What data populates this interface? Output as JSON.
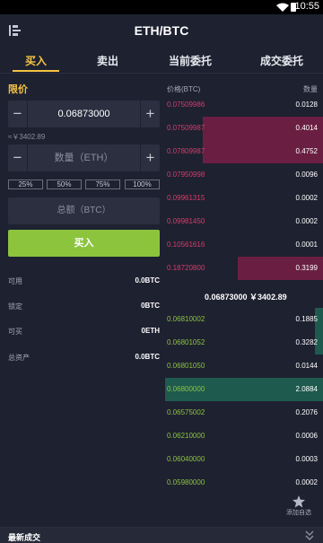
{
  "status_bar": {
    "time": "10:55",
    "wifi_icon": "wifi-icon",
    "battery_icon": "battery-icon"
  },
  "header": {
    "title": "ETH/BTC",
    "back_icon": "switch-pair-icon"
  },
  "tabs": [
    {
      "label": "买入",
      "active": true
    },
    {
      "label": "卖出",
      "active": false
    },
    {
      "label": "当前委托",
      "active": false
    },
    {
      "label": "成交委托",
      "active": false
    }
  ],
  "order_form": {
    "order_type": "限价",
    "price_value": "0.06873000",
    "price_cny": "≈￥3402.89",
    "amount_placeholder": "数量（ETH）",
    "percents": [
      "25%",
      "50%",
      "75%",
      "100%"
    ],
    "total_placeholder": "总额（BTC）",
    "buy_label": "买入",
    "minus_label": "−",
    "plus_label": "+"
  },
  "balances": [
    {
      "label": "可用",
      "value": "0.0BTC"
    },
    {
      "label": "锁定",
      "value": "0BTC"
    },
    {
      "label": "可买",
      "value": "0ETH"
    },
    {
      "label": "总资产",
      "value": "0.0BTC"
    }
  ],
  "orderbook": {
    "header_price": "价格(BTC)",
    "header_qty": "数量",
    "asks": [
      {
        "price": "0.07509986",
        "qty": "0.0128",
        "depth": 0.0
      },
      {
        "price": "0.07509987",
        "qty": "0.4014",
        "depth": 0.76
      },
      {
        "price": "0.07809987",
        "qty": "0.4752",
        "depth": 0.76
      },
      {
        "price": "0.07950998",
        "qty": "0.0096",
        "depth": 0.0
      },
      {
        "price": "0.09961315",
        "qty": "0.0002",
        "depth": 0.0
      },
      {
        "price": "0.09981450",
        "qty": "0.0002",
        "depth": 0.0
      },
      {
        "price": "0.10561616",
        "qty": "0.0001",
        "depth": 0.0
      },
      {
        "price": "0.18720800",
        "qty": "0.3199",
        "depth": 0.54
      }
    ],
    "mid_price": "0.06873000 ￥3402.89",
    "bids": [
      {
        "price": "0.06810002",
        "qty": "0.1885",
        "depth": 0.05
      },
      {
        "price": "0.06801052",
        "qty": "0.3282",
        "depth": 0.05
      },
      {
        "price": "0.06801050",
        "qty": "0.0144",
        "depth": 0.0
      },
      {
        "price": "0.06800000",
        "qty": "2.0884",
        "depth": 1.0
      },
      {
        "price": "0.06575002",
        "qty": "0.2076",
        "depth": 0.0
      },
      {
        "price": "0.06210000",
        "qty": "0.0006",
        "depth": 0.0
      },
      {
        "price": "0.06040000",
        "qty": "0.0003",
        "depth": 0.0
      },
      {
        "price": "0.05980000",
        "qty": "0.0002",
        "depth": 0.0
      }
    ]
  },
  "fab": {
    "label": "添加自选",
    "icon": "star-icon"
  },
  "bottom": {
    "title": "最新成交",
    "icon": "chevron-double-down-icon"
  },
  "colors": {
    "accent": "#f5c342",
    "buy": "#8cc43e",
    "sell": "#d63c6a"
  }
}
